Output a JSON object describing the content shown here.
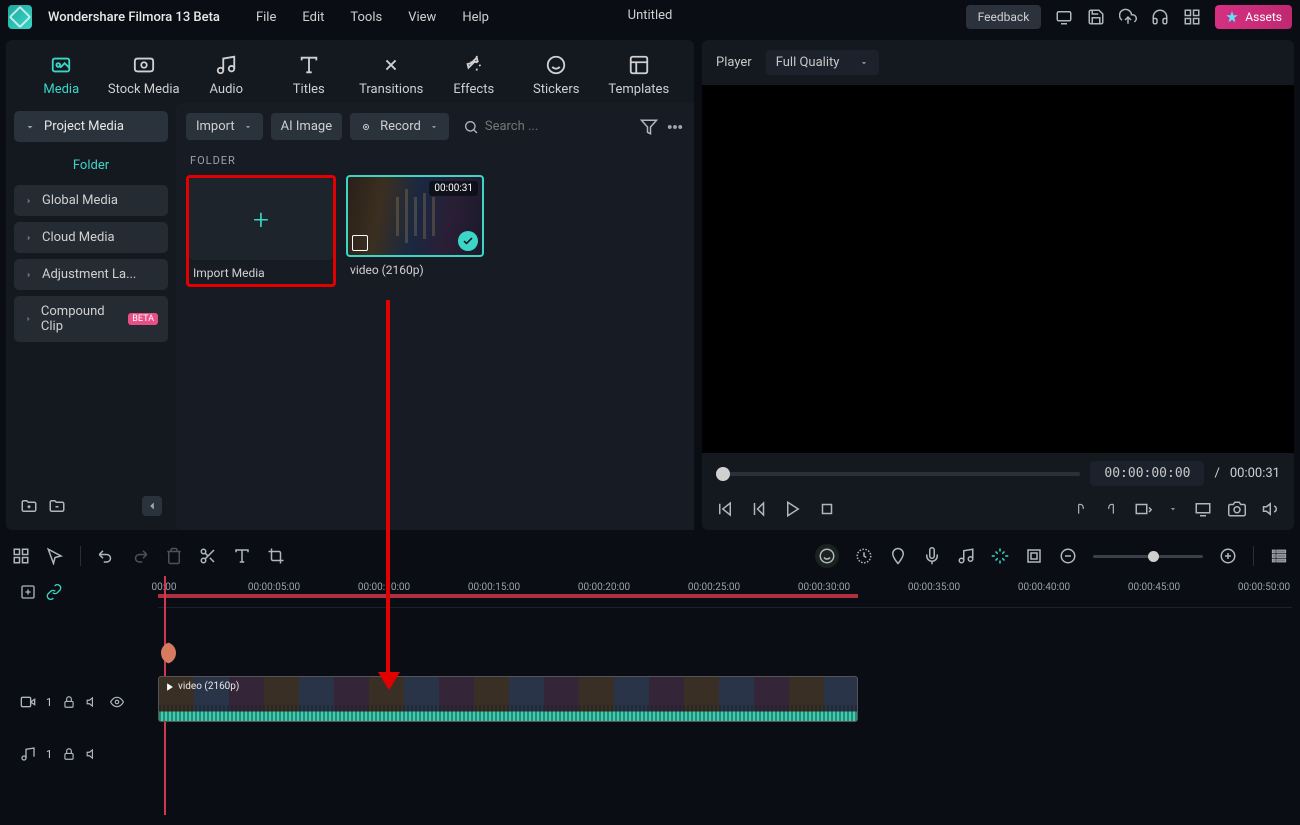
{
  "app": {
    "title": "Wondershare Filmora 13 Beta",
    "document_title": "Untitled"
  },
  "menu": {
    "file": "File",
    "edit": "Edit",
    "tools": "Tools",
    "view": "View",
    "help": "Help"
  },
  "titlebar": {
    "feedback": "Feedback",
    "assets": "Assets"
  },
  "tabs": {
    "media": "Media",
    "stock": "Stock Media",
    "audio": "Audio",
    "titles": "Titles",
    "transitions": "Transitions",
    "effects": "Effects",
    "stickers": "Stickers",
    "templates": "Templates"
  },
  "sidebar": {
    "project_media": "Project Media",
    "folder": "Folder",
    "global_media": "Global Media",
    "cloud_media": "Cloud Media",
    "adjustment": "Adjustment La...",
    "compound": "Compound Clip",
    "beta_badge": "BETA"
  },
  "toolbar": {
    "import": "Import",
    "ai_image": "AI Image",
    "record": "Record",
    "search_placeholder": "Search ..."
  },
  "content": {
    "folder_heading": "FOLDER",
    "import_media_label": "Import Media",
    "video_label": "video (2160p)",
    "video_duration": "00:00:31"
  },
  "player": {
    "label": "Player",
    "quality": "Full Quality",
    "current_time": "00:00:00:00",
    "separator": "/",
    "total_time": "00:00:31"
  },
  "timeline": {
    "ticks": [
      "00:00",
      "00:00:05:00",
      "00:00:10:00",
      "00:00:15:00",
      "00:00:20:00",
      "00:00:25:00",
      "00:00:30:00",
      "00:00:35:00",
      "00:00:40:00",
      "00:00:45:00",
      "00:00:50:00"
    ],
    "clip_label": "video (2160p)",
    "video_track_num": "1",
    "audio_track_num": "1"
  }
}
